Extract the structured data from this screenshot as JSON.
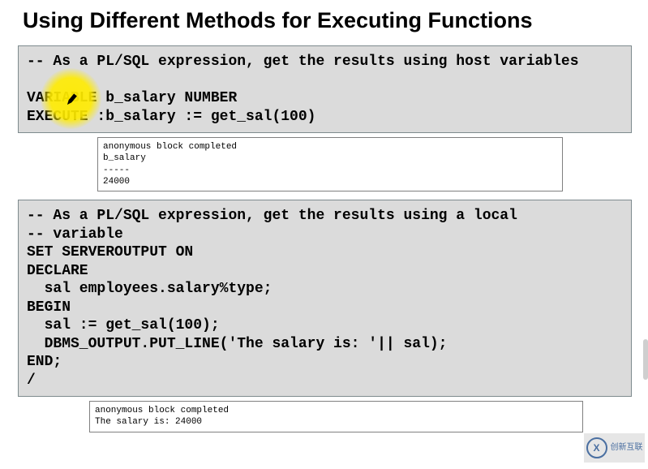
{
  "title": "Using Different Methods for Executing Functions",
  "code1": "-- As a PL/SQL expression, get the results using host variables\n\nVARIABLE b_salary NUMBER\nEXECUTE :b_salary := get_sal(100)",
  "output1": "anonymous block completed\nb_salary\n-----\n24000",
  "code2": "-- As a PL/SQL expression, get the results using a local\n-- variable\nSET SERVEROUTPUT ON\nDECLARE\n  sal employees.salary%type;\nBEGIN\n  sal := get_sal(100);\n  DBMS_OUTPUT.PUT_LINE('The salary is: '|| sal);\nEND;\n/",
  "output2": "anonymous block completed\nThe salary is: 24000",
  "watermark": {
    "logo_letter": "X",
    "text": "创新互联"
  }
}
